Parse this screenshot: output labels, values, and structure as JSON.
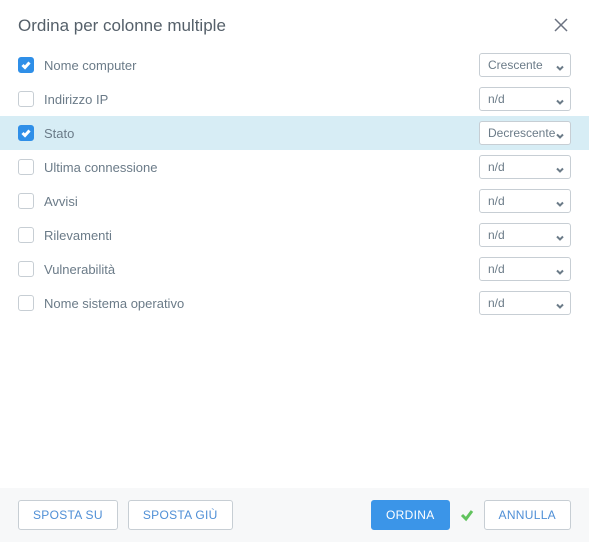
{
  "header": {
    "title": "Ordina per colonne multiple"
  },
  "select_options": {
    "asc": "Crescente",
    "desc": "Decrescente",
    "na": "n/d"
  },
  "rows": [
    {
      "label": "Nome computer",
      "checked": true,
      "selected": false,
      "value": "Crescente"
    },
    {
      "label": "Indirizzo IP",
      "checked": false,
      "selected": false,
      "value": "n/d"
    },
    {
      "label": "Stato",
      "checked": true,
      "selected": true,
      "value": "Decrescente"
    },
    {
      "label": "Ultima connessione",
      "checked": false,
      "selected": false,
      "value": "n/d"
    },
    {
      "label": "Avvisi",
      "checked": false,
      "selected": false,
      "value": "n/d"
    },
    {
      "label": "Rilevamenti",
      "checked": false,
      "selected": false,
      "value": "n/d"
    },
    {
      "label": "Vulnerabilità",
      "checked": false,
      "selected": false,
      "value": "n/d"
    },
    {
      "label": "Nome sistema operativo",
      "checked": false,
      "selected": false,
      "value": "n/d"
    }
  ],
  "footer": {
    "move_up": "SPOSTA SU",
    "move_down": "SPOSTA GIÙ",
    "sort": "ORDINA",
    "cancel": "ANNULLA"
  }
}
